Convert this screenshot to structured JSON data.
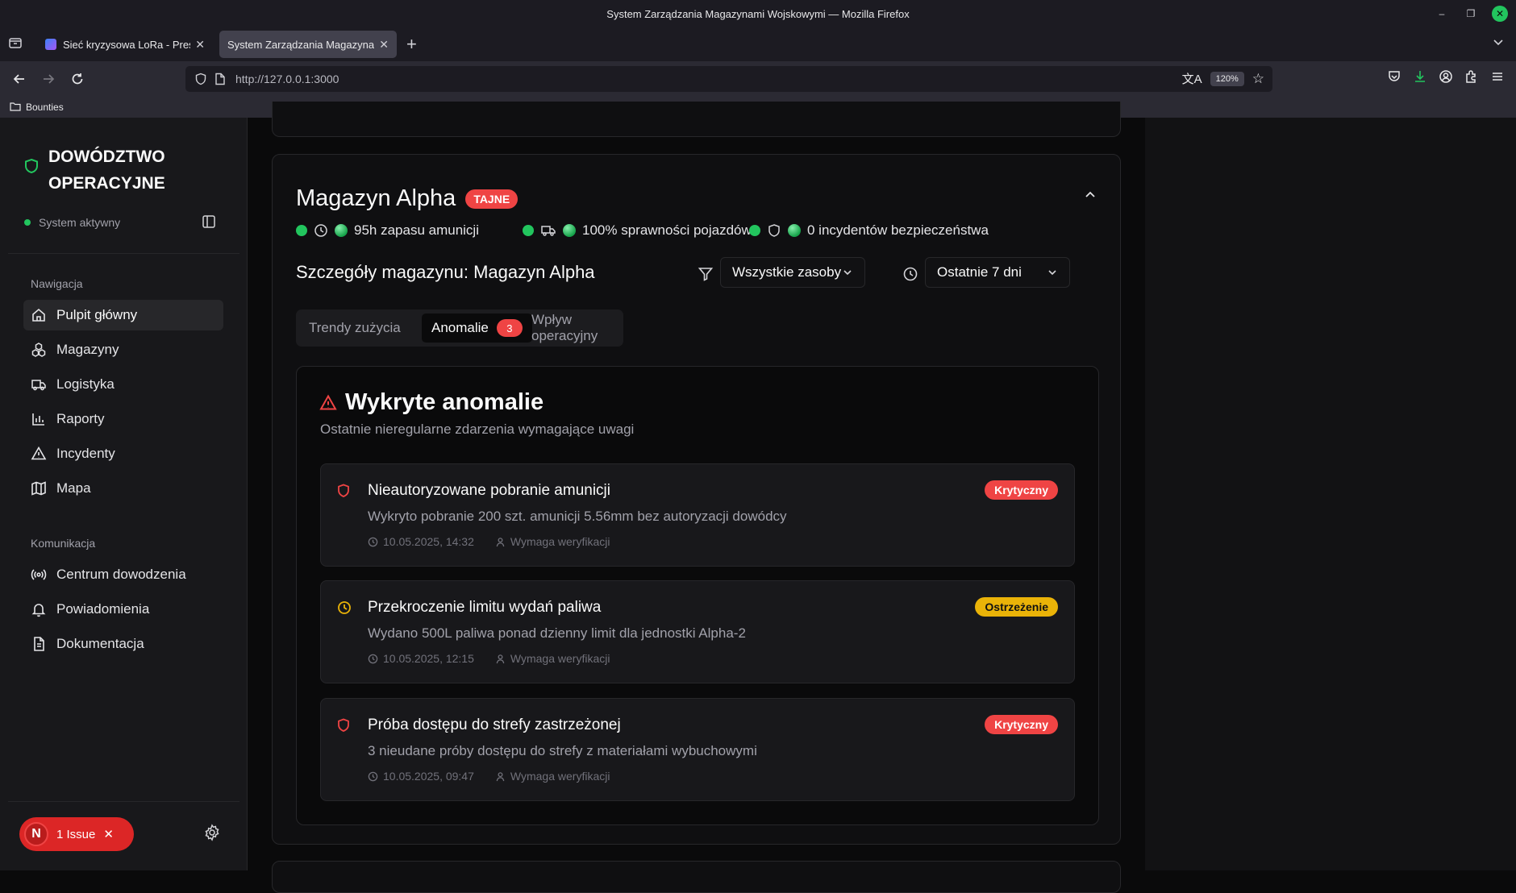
{
  "browser": {
    "window_title": "System Zarządzania Magazynami Wojskowymi — Mozilla Firefox",
    "tabs": [
      {
        "label": "Sieć kryzysowa LoRa - Prese",
        "active": false
      },
      {
        "label": "System Zarządzania Magazynam",
        "active": true
      }
    ],
    "url": "http://127.0.0.1:3000",
    "zoom": "120%",
    "bookmark": "Bounties"
  },
  "sidebar": {
    "brand_line1": "DOWÓDZTWO",
    "brand_line2": "OPERACYJNE",
    "status": "System aktywny",
    "nav_section": "Nawigacja",
    "nav_items": [
      {
        "label": "Pulpit główny",
        "icon": "home-icon",
        "active": true
      },
      {
        "label": "Magazyny",
        "icon": "boxes-icon"
      },
      {
        "label": "Logistyka",
        "icon": "truck-icon"
      },
      {
        "label": "Raporty",
        "icon": "chart-icon"
      },
      {
        "label": "Incydenty",
        "icon": "warning-icon"
      },
      {
        "label": "Mapa",
        "icon": "map-icon"
      }
    ],
    "comm_section": "Komunikacja",
    "comm_items": [
      {
        "label": "Centrum dowodzenia",
        "icon": "radio-icon"
      },
      {
        "label": "Powiadomienia",
        "icon": "bell-icon"
      },
      {
        "label": "Dokumentacja",
        "icon": "document-icon"
      }
    ],
    "issue_avatar": "N",
    "issue_label": "1 Issue"
  },
  "warehouse": {
    "name": "Magazyn Alpha",
    "classification": "TAJNE",
    "stats": [
      "95h zapasu amunicji",
      "100% sprawności pojazdów",
      "0 incydentów bezpieczeństwa"
    ],
    "details_title": "Szczegóły magazynu: Magazyn Alpha",
    "filter_value": "Wszystkie zasoby",
    "period_value": "Ostatnie 7 dni",
    "tabs": [
      {
        "label": "Trendy zużycia"
      },
      {
        "label": "Anomalie",
        "count": "3",
        "active": true
      },
      {
        "label": "Wpływ operacyjny"
      }
    ]
  },
  "anomalies": {
    "title": "Wykryte anomalie",
    "subtitle": "Ostatnie nieregularne zdarzenia wymagające uwagi",
    "items": [
      {
        "title": "Nieautoryzowane pobranie amunicji",
        "description": "Wykryto pobranie 200 szt. amunicji 5.56mm bez autoryzacji dowódcy",
        "time": "10.05.2025, 14:32",
        "status": "Wymaga weryfikacji",
        "severity": "Krytyczny",
        "icon": "shield-icon"
      },
      {
        "title": "Przekroczenie limitu wydań paliwa",
        "description": "Wydano 500L paliwa ponad dzienny limit dla jednostki Alpha-2",
        "time": "10.05.2025, 12:15",
        "status": "Wymaga weryfikacji",
        "severity": "Ostrzeżenie",
        "icon": "clock-icon"
      },
      {
        "title": "Próba dostępu do strefy zastrzeżonej",
        "description": "3 nieudane próby dostępu do strefy z materiałami wybuchowymi",
        "time": "10.05.2025, 09:47",
        "status": "Wymaga weryfikacji",
        "severity": "Krytyczny",
        "icon": "shield-icon"
      }
    ]
  },
  "colors": {
    "accent_green": "#22c55e",
    "critical": "#ef4444",
    "warning": "#eab308"
  }
}
